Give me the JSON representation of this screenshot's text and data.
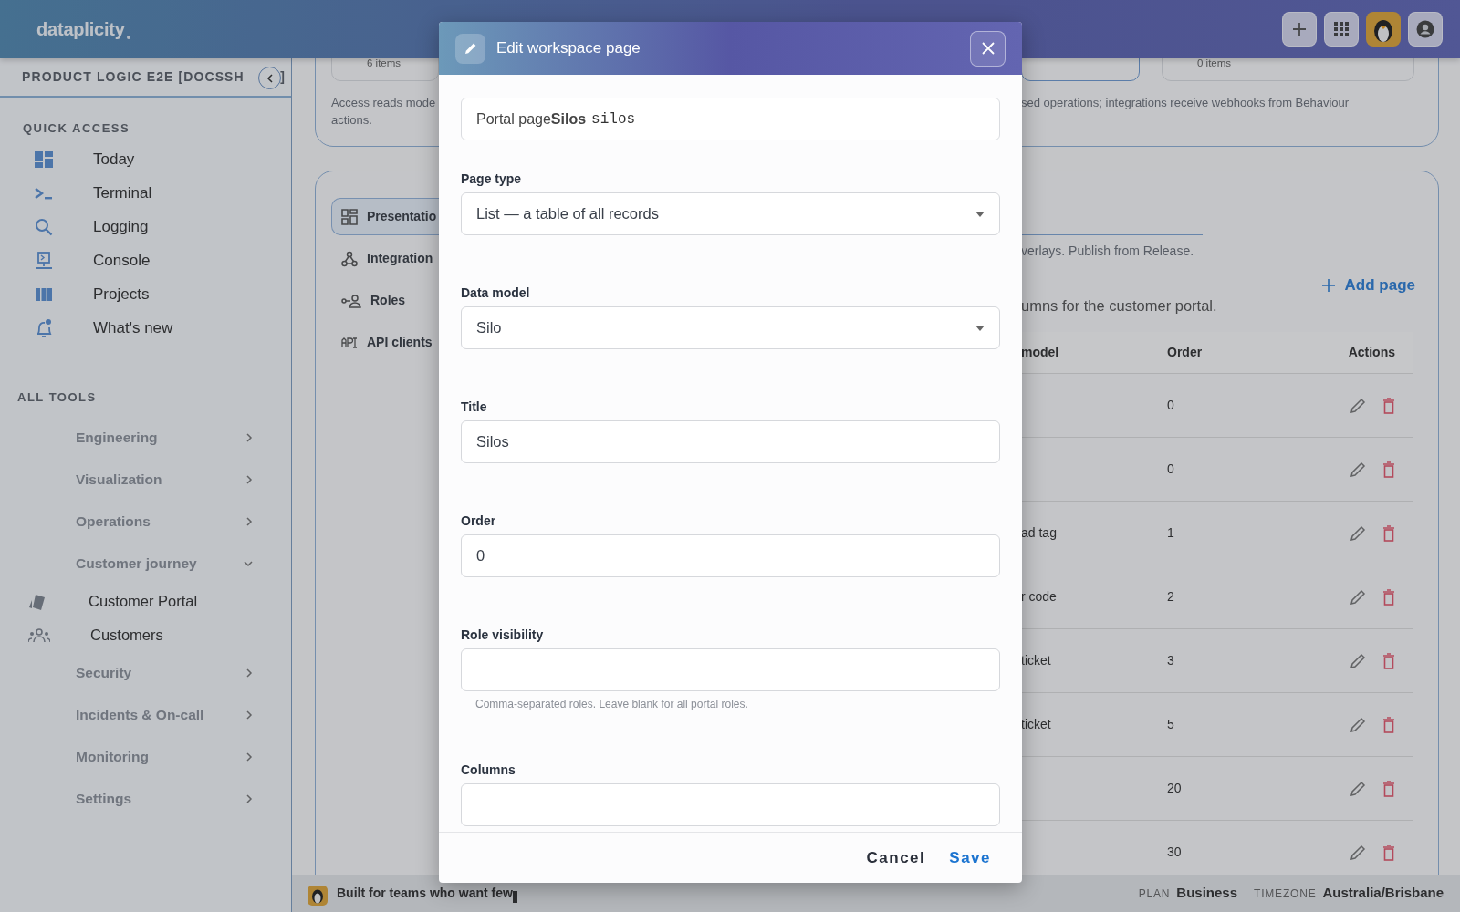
{
  "topbar": {
    "logo": "dataplicity"
  },
  "sidebar": {
    "workspace": "PRODUCT LOGIC E2E [DOCSSH",
    "workspace_end": "]",
    "quick_access_title": "QUICK ACCESS",
    "quick_access": [
      {
        "label": "Today"
      },
      {
        "label": "Terminal"
      },
      {
        "label": "Logging"
      },
      {
        "label": "Console"
      },
      {
        "label": "Projects"
      },
      {
        "label": "What's new"
      }
    ],
    "all_tools_title": "ALL TOOLS",
    "tools": [
      {
        "label": "Engineering",
        "expanded": false
      },
      {
        "label": "Visualization",
        "expanded": false
      },
      {
        "label": "Operations",
        "expanded": false
      },
      {
        "label": "Customer journey",
        "expanded": true,
        "children": [
          {
            "label": "Customer Portal"
          },
          {
            "label": "Customers"
          }
        ]
      },
      {
        "label": "Security",
        "expanded": false
      },
      {
        "label": "Incidents & On-call",
        "expanded": false
      },
      {
        "label": "Monitoring",
        "expanded": false
      },
      {
        "label": "Settings",
        "expanded": false
      }
    ]
  },
  "overview_card": {
    "left_tile": {
      "count": "6 items"
    },
    "left_text": [
      "Access reads mode",
      "actions."
    ],
    "right_tiles": [
      {
        "selected": true
      },
      {
        "selected": false,
        "count": "0 items"
      }
    ],
    "right_text": "sed operations; integrations receive webhooks from Behaviour"
  },
  "pages_card": {
    "nav": [
      {
        "label": "Presentatio",
        "selected": true
      },
      {
        "label": "Integration",
        "selected": false
      },
      {
        "label": "Roles",
        "selected": false
      },
      {
        "label": "API clients",
        "selected": false
      }
    ],
    "subtitle": "verlays. Publish from Release.",
    "add_button": "Add page",
    "intro": "umns for the customer portal.",
    "table": {
      "columns": [
        "model",
        "Order",
        "Actions"
      ],
      "rows": [
        {
          "order": "0"
        },
        {
          "order": "0"
        },
        {
          "model": "ad tag",
          "order": "1"
        },
        {
          "model": "r code",
          "order": "2"
        },
        {
          "model": "ticket",
          "order": "3"
        },
        {
          "model": "ticket",
          "order": "5"
        },
        {
          "order": "20"
        },
        {
          "order": "30"
        }
      ]
    }
  },
  "modal": {
    "title": "Edit workspace page",
    "summary": "Portal page**Silos**",
    "slug": "silos",
    "fields": [
      {
        "kind": "select",
        "label": "Page type",
        "value": "List — a table of all records"
      },
      {
        "kind": "select",
        "label": "Data model",
        "value": "Silo"
      },
      {
        "kind": "text",
        "label": "Title",
        "value": "Silos"
      },
      {
        "kind": "text",
        "label": "Order",
        "value": "0"
      },
      {
        "kind": "text",
        "label": "Role visibility",
        "hint": "Comma-separated roles. Leave blank for all portal roles."
      },
      {
        "kind": "text",
        "label": "Columns"
      }
    ],
    "buttons": [
      {
        "kind": "secondary",
        "label": "Cancel"
      },
      {
        "kind": "primary",
        "label": "Save"
      }
    ]
  },
  "footer": {
    "tagline": "Built for teams who want few",
    "plan_label": "PLAN",
    "plan": "Business",
    "timezone_label": "TIMEZONE",
    "timezone": "Australia/Brisbane"
  }
}
